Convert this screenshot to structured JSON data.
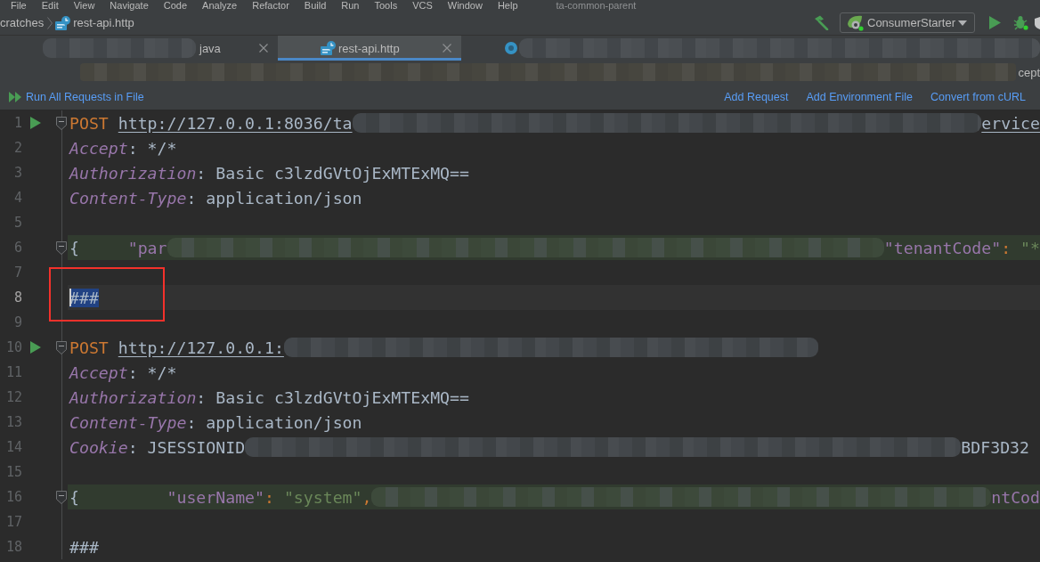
{
  "window": {
    "title": "ta-common-parent"
  },
  "menu": [
    "File",
    "Edit",
    "View",
    "Navigate",
    "Code",
    "Analyze",
    "Refactor",
    "Build",
    "Run",
    "Tools",
    "VCS",
    "Window",
    "Help"
  ],
  "breadcrumb": [
    {
      "label": "cratches",
      "kind": "folder"
    },
    {
      "label": "rest-api.http",
      "kind": "http"
    }
  ],
  "run_config": {
    "label": "ConsumerStarter"
  },
  "tabs": [
    {
      "label": "java",
      "kind": "java",
      "selected": false,
      "redacted": true
    },
    {
      "label": "rest-api.http",
      "kind": "http",
      "selected": true,
      "redacted": false
    }
  ],
  "second_tab_row": {
    "text": "cept"
  },
  "request_toolbar": {
    "run_all": "Run All Requests in File",
    "links": [
      "Add Request",
      "Add Environment File",
      "Convert from cURL"
    ]
  },
  "editor": {
    "lines": [
      {
        "number": "1",
        "kind": "request",
        "runnable": true,
        "foldable": true,
        "current": false,
        "tokens": [
          {
            "kind": "method",
            "text": "POST"
          },
          {
            "kind": "url",
            "text": "http://127.0.0.1:8036/ta"
          },
          {
            "kind": "redacted"
          },
          {
            "kind": "url",
            "text": "ervice"
          }
        ]
      },
      {
        "number": "2",
        "kind": "header",
        "runnable": false,
        "foldable": false,
        "current": false,
        "tokens": [
          {
            "kind": "header-name",
            "text": "Accept"
          },
          {
            "kind": "header-value",
            "text": ": */*"
          }
        ]
      },
      {
        "number": "3",
        "kind": "header",
        "runnable": false,
        "foldable": false,
        "current": false,
        "tokens": [
          {
            "kind": "header-name",
            "text": "Authorization"
          },
          {
            "kind": "header-value",
            "text": ": Basic c3lzdGVtOjExMTExMQ=="
          }
        ]
      },
      {
        "number": "4",
        "kind": "header",
        "runnable": false,
        "foldable": false,
        "current": false,
        "tokens": [
          {
            "kind": "header-name",
            "text": "Content-Type"
          },
          {
            "kind": "header-value",
            "text": ": application/json"
          }
        ]
      },
      {
        "number": "5",
        "kind": "blank",
        "runnable": false,
        "foldable": false,
        "current": false
      },
      {
        "number": "6",
        "kind": "json",
        "runnable": false,
        "foldable": true,
        "current": false,
        "tokens": [
          {
            "kind": "brace",
            "text": "{"
          },
          {
            "kind": "key",
            "text": "     \"par"
          },
          {
            "kind": "redacted"
          },
          {
            "kind": "key",
            "text": "\"tenantCode\""
          },
          {
            "kind": "punct",
            "text": ":"
          },
          {
            "kind": "string",
            "text": "\"*"
          }
        ]
      },
      {
        "number": "7",
        "kind": "blank",
        "runnable": false,
        "foldable": false,
        "current": false
      },
      {
        "number": "8",
        "kind": "separator",
        "runnable": false,
        "foldable": false,
        "current": true,
        "tokens": [
          {
            "kind": "separator",
            "text": "###",
            "selected": true
          }
        ]
      },
      {
        "number": "9",
        "kind": "blank",
        "runnable": false,
        "foldable": false,
        "current": false
      },
      {
        "number": "10",
        "kind": "request",
        "runnable": true,
        "foldable": true,
        "current": false,
        "tokens": [
          {
            "kind": "method",
            "text": "POST"
          },
          {
            "kind": "url",
            "text": "http://127.0.0.1:"
          },
          {
            "kind": "redacted"
          }
        ]
      },
      {
        "number": "11",
        "kind": "header",
        "runnable": false,
        "foldable": false,
        "current": false,
        "tokens": [
          {
            "kind": "header-name",
            "text": "Accept"
          },
          {
            "kind": "header-value",
            "text": ": */*"
          }
        ]
      },
      {
        "number": "12",
        "kind": "header",
        "runnable": false,
        "foldable": false,
        "current": false,
        "tokens": [
          {
            "kind": "header-name",
            "text": "Authorization"
          },
          {
            "kind": "header-value",
            "text": ": Basic c3lzdGVtOjExMTExMQ=="
          }
        ]
      },
      {
        "number": "13",
        "kind": "header",
        "runnable": false,
        "foldable": false,
        "current": false,
        "tokens": [
          {
            "kind": "header-name",
            "text": "Content-Type"
          },
          {
            "kind": "header-value",
            "text": ": application/json"
          }
        ]
      },
      {
        "number": "14",
        "kind": "header",
        "runnable": false,
        "foldable": false,
        "current": false,
        "tokens": [
          {
            "kind": "header-name",
            "text": "Cookie"
          },
          {
            "kind": "header-value",
            "text": ": JSESSIONID"
          },
          {
            "kind": "redacted"
          },
          {
            "kind": "header-value",
            "text": "BDF3D32"
          }
        ]
      },
      {
        "number": "15",
        "kind": "blank",
        "runnable": false,
        "foldable": false,
        "current": false
      },
      {
        "number": "16",
        "kind": "json",
        "runnable": false,
        "foldable": true,
        "current": false,
        "tokens": [
          {
            "kind": "brace",
            "text": "{"
          },
          {
            "kind": "key",
            "text": "         \"userName\""
          },
          {
            "kind": "punct",
            "text": ":"
          },
          {
            "kind": "string",
            "text": "\"system\""
          },
          {
            "kind": "punct",
            "text": ","
          },
          {
            "kind": "redacted"
          },
          {
            "kind": "key",
            "text": "ntCod"
          }
        ]
      },
      {
        "number": "17",
        "kind": "blank",
        "runnable": false,
        "foldable": false,
        "current": false
      },
      {
        "number": "18",
        "kind": "separator",
        "runnable": false,
        "foldable": false,
        "current": false,
        "tokens": [
          {
            "kind": "separator",
            "text": "###",
            "selected": false
          }
        ]
      }
    ]
  }
}
